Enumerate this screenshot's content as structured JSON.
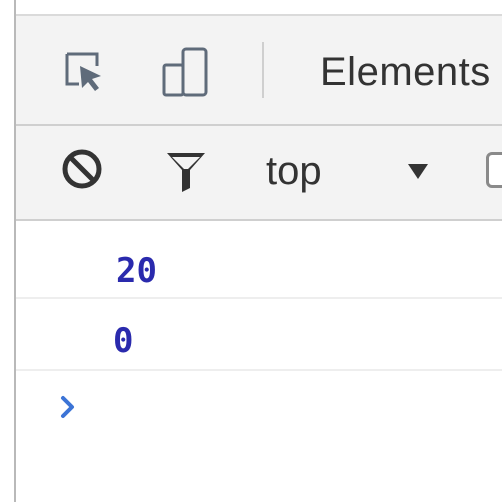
{
  "devtools": {
    "main_toolbar": {
      "inspect_icon": "inspect-element-icon",
      "device_icon": "device-toolbar-icon",
      "active_tab": "Elements"
    },
    "console_toolbar": {
      "clear_icon": "clear-console-icon",
      "filter_icon": "filter-icon",
      "context": "top",
      "dropdown_icon": "dropdown-arrow-icon"
    },
    "console": {
      "messages": [
        "20",
        "0"
      ],
      "prompt_icon": "prompt-chevron-icon",
      "value_color": "#2a2aad",
      "prompt_color": "#3c74d6"
    }
  }
}
